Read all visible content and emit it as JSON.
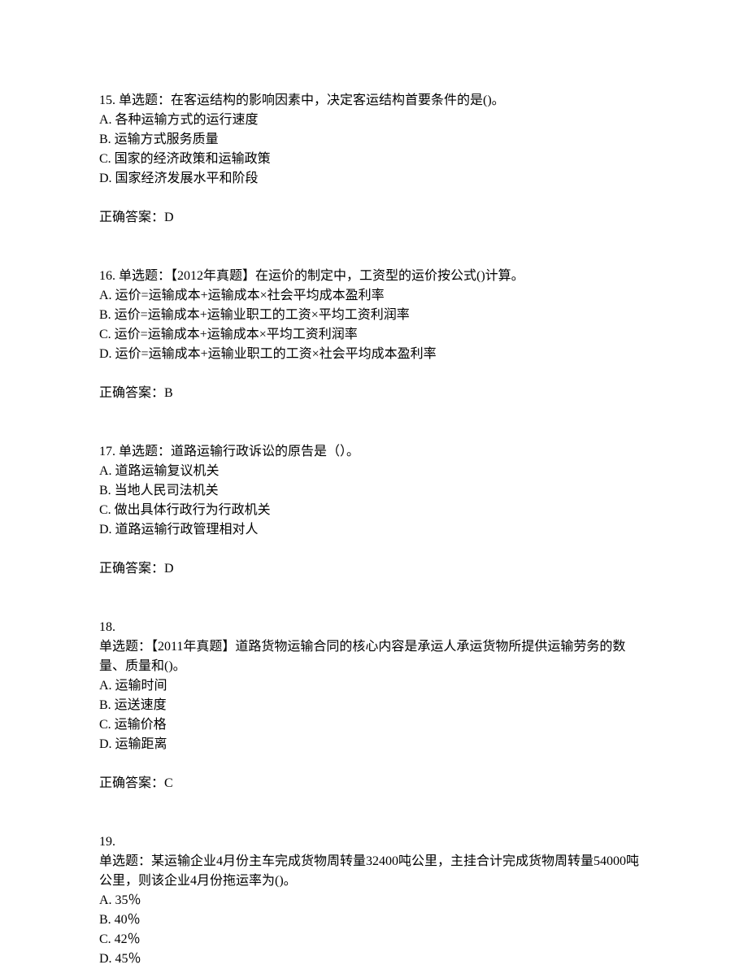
{
  "questions": [
    {
      "number": "15.   单选题：在客运结构的影响因素中，决定客运结构首要条件的是()。",
      "options": [
        "A. 各种运输方式的运行速度",
        "B. 运输方式服务质量",
        "C. 国家的经济政策和运输政策",
        "D. 国家经济发展水平和阶段"
      ],
      "answer": "正确答案：D"
    },
    {
      "number": "16.   单选题：【2012年真题】在运价的制定中，工资型的运价按公式()计算。",
      "options": [
        "A. 运价=运输成本+运输成本×社会平均成本盈利率",
        "B. 运价=运输成本+运输业职工的工资×平均工资利润率",
        "C. 运价=运输成本+运输成本×平均工资利润率",
        "D. 运价=运输成本+运输业职工的工资×社会平均成本盈利率"
      ],
      "answer": "正确答案：B"
    },
    {
      "number": "17.   单选题：道路运输行政诉讼的原告是（）。",
      "options": [
        "A. 道路运输复议机关",
        "B. 当地人民司法机关",
        "C. 做出具体行政行为行政机关",
        "D. 道路运输行政管理相对人"
      ],
      "answer": "正确答案：D"
    },
    {
      "number_line1": "18.",
      "number_line2": "单选题：【2011年真题】道路货物运输合同的核心内容是承运人承运货物所提供运输劳务的数量、质量和()。",
      "options": [
        "A. 运输时间",
        "B. 运送速度",
        "C. 运输价格",
        "D. 运输距离"
      ],
      "answer": "正确答案：C"
    },
    {
      "number_line1": "19.",
      "number_line2": "单选题：某运输企业4月份主车完成货物周转量32400吨公里，主挂合计完成货物周转量54000吨公里，则该企业4月份拖运率为()。",
      "options": [
        "A. 35％",
        "B. 40％",
        "C. 42％",
        "D. 45％"
      ],
      "answer": ""
    }
  ]
}
